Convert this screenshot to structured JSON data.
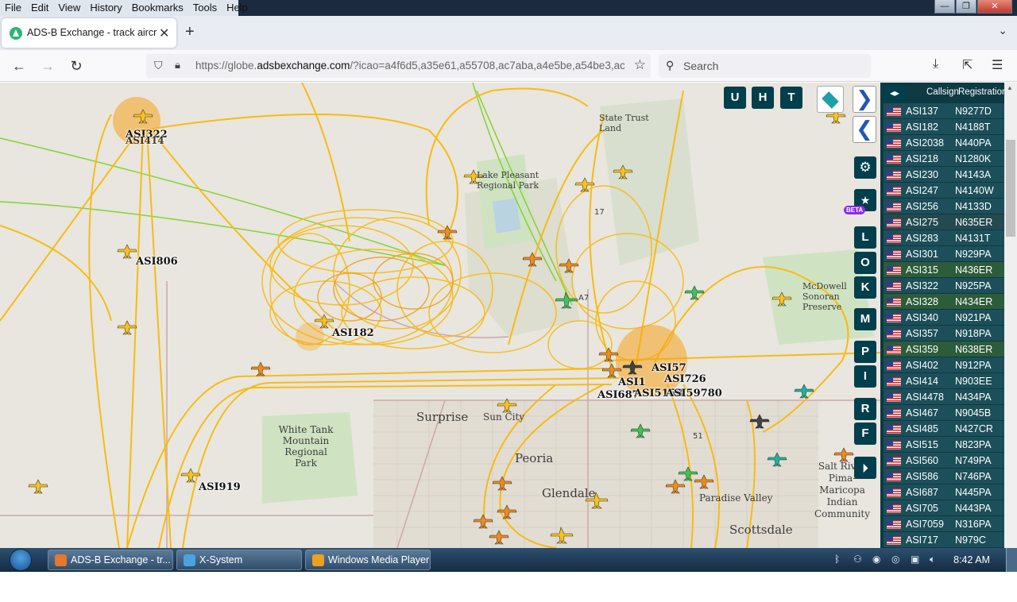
{
  "menubar": {
    "items": [
      "File",
      "Edit",
      "View",
      "History",
      "Bookmarks",
      "Tools",
      "Help"
    ]
  },
  "window_controls": {
    "minimize": "—",
    "maximize": "❐",
    "close": "✕"
  },
  "tab": {
    "title": "ADS-B Exchange - track aircraft",
    "close": "✕"
  },
  "newtab": "+",
  "nav": {
    "url_prefix": "https://globe.",
    "url_domain": "adsbexchange.com",
    "url_rest": "/?icao=a4f6d5,a35e61,a55708,ac7aba,a4e5be,a54be3,ac",
    "search_placeholder": "Search"
  },
  "map": {
    "place_labels": [
      {
        "text": "State Trust Land",
        "key": "state-trust"
      },
      {
        "text": "Lake Pleasant Regional Park",
        "key": "lake-pleasant"
      },
      {
        "text": "McDowell Sonoran Preserve",
        "key": "mcdowell"
      },
      {
        "text": "White Tank Mountain Regional Park",
        "key": "white-tank"
      },
      {
        "text": "Surprise",
        "key": "surprise"
      },
      {
        "text": "Sun City",
        "key": "sun-city"
      },
      {
        "text": "Peoria",
        "key": "peoria"
      },
      {
        "text": "Glendale",
        "key": "glendale"
      },
      {
        "text": "Paradise Valley",
        "key": "paradise-valley"
      },
      {
        "text": "Scottsdale",
        "key": "scottsdale"
      },
      {
        "text": "Salt River Pima-Maricopa Indian Community",
        "key": "salt-river"
      },
      {
        "text": "A7",
        "key": "a7"
      },
      {
        "text": "51",
        "key": "r51"
      },
      {
        "text": "17",
        "key": "r17"
      }
    ],
    "aircraft_labels": [
      "ASI322",
      "ASI414",
      "ASI806",
      "ASI182",
      "ASI919",
      "ASI687",
      "ASI726",
      "ASI5158",
      "ASI59780",
      "ASI1",
      "ASI57"
    ],
    "colors": {
      "track": "#f9b90b",
      "track_dark": "#f29a06",
      "green_track": "#7ad11e",
      "water": "#b9d3e3",
      "park": "#cfe3c2"
    }
  },
  "controls": {
    "top_buttons": [
      "U",
      "H",
      "T"
    ],
    "side_buttons": [
      "L",
      "O",
      "K",
      "M",
      "P",
      "I",
      "R",
      "F"
    ],
    "beta": "BETA",
    "next_arrow": "❯",
    "prev_arrow": "❮"
  },
  "table": {
    "toggle": "◂▸",
    "headers": {
      "callsign": "Callsign",
      "registration": "Registration"
    },
    "rows": [
      {
        "callsign": "ASI137",
        "reg": "N9277D"
      },
      {
        "callsign": "ASI182",
        "reg": "N4188T"
      },
      {
        "callsign": "ASI2038",
        "reg": "N440PA"
      },
      {
        "callsign": "ASI218",
        "reg": "N1280K"
      },
      {
        "callsign": "ASI230",
        "reg": "N4143A"
      },
      {
        "callsign": "ASI247",
        "reg": "N4140W"
      },
      {
        "callsign": "ASI256",
        "reg": "N4133D"
      },
      {
        "callsign": "ASI275",
        "reg": "N635ER"
      },
      {
        "callsign": "ASI283",
        "reg": "N4131T"
      },
      {
        "callsign": "ASI301",
        "reg": "N929PA"
      },
      {
        "callsign": "ASI315",
        "reg": "N436ER"
      },
      {
        "callsign": "ASI322",
        "reg": "N925PA"
      },
      {
        "callsign": "ASI328",
        "reg": "N434ER"
      },
      {
        "callsign": "ASI340",
        "reg": "N921PA"
      },
      {
        "callsign": "ASI357",
        "reg": "N918PA"
      },
      {
        "callsign": "ASI359",
        "reg": "N638ER"
      },
      {
        "callsign": "ASI402",
        "reg": "N912PA"
      },
      {
        "callsign": "ASI414",
        "reg": "N903EE"
      },
      {
        "callsign": "ASI4478",
        "reg": "N434PA"
      },
      {
        "callsign": "ASI467",
        "reg": "N9045B"
      },
      {
        "callsign": "ASI485",
        "reg": "N427CR"
      },
      {
        "callsign": "ASI515",
        "reg": "N823PA"
      },
      {
        "callsign": "ASI560",
        "reg": "N749PA"
      },
      {
        "callsign": "ASI586",
        "reg": "N746PA"
      },
      {
        "callsign": "ASI687",
        "reg": "N445PA"
      },
      {
        "callsign": "ASI705",
        "reg": "N443PA"
      },
      {
        "callsign": "ASI7059",
        "reg": "N316PA"
      },
      {
        "callsign": "ASI717",
        "reg": "N979C"
      }
    ]
  },
  "taskbar": {
    "tasks": [
      {
        "label": "ADS-B Exchange - tr...",
        "icon_color": "#e8762b"
      },
      {
        "label": "X-System",
        "icon_color": "#4aa3e0"
      },
      {
        "label": "Windows Media Player",
        "icon_color": "#f0a020"
      }
    ],
    "clock": "8:42 AM"
  }
}
